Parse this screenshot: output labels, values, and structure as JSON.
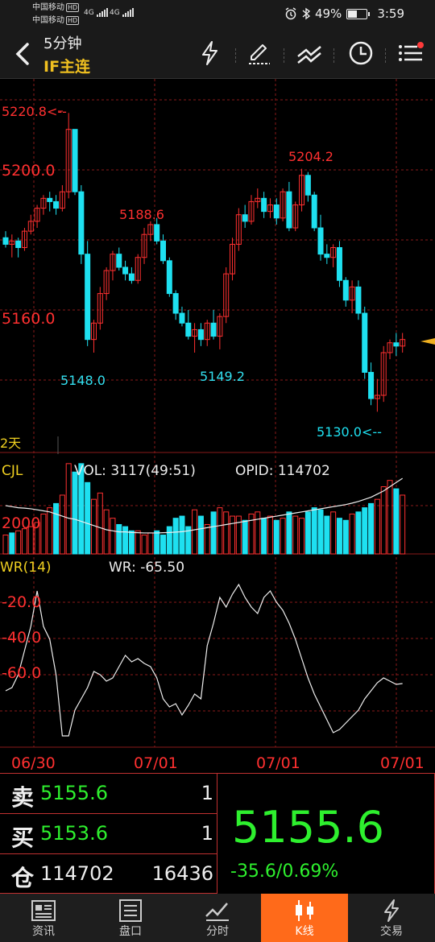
{
  "status_bar": {
    "carrier1": "中国移动",
    "carrier2": "中国移动",
    "hd": "HD",
    "net1": "4G",
    "net2": "4G",
    "battery": "49%",
    "time": "3:59"
  },
  "header": {
    "title": "5分钟",
    "contract": "IF主连"
  },
  "chart_data": {
    "type": "candlestick",
    "period": "5分钟",
    "price_panel": {
      "ylim": [
        5122,
        5225
      ],
      "y_labels": [
        "5200.0",
        "5160.0"
      ],
      "high_label": "5220.8<--",
      "low_label": "5130.0<--",
      "annotations": [
        {
          "text": "5188.6",
          "color": "#ff3030"
        },
        {
          "text": "5204.2",
          "color": "#ff3030"
        },
        {
          "text": "5148.0",
          "color": "#33e0f0"
        },
        {
          "text": "5149.2",
          "color": "#33e0f0"
        }
      ],
      "session_label": "2天",
      "candles": [
        [
          5183,
          5185,
          5180,
          5181
        ],
        [
          5181,
          5184,
          5177,
          5182
        ],
        [
          5182,
          5183,
          5177,
          5180
        ],
        [
          5180,
          5186,
          5179,
          5185
        ],
        [
          5185,
          5190,
          5184,
          5188
        ],
        [
          5188,
          5193,
          5186,
          5192
        ],
        [
          5192,
          5196,
          5190,
          5195
        ],
        [
          5195,
          5197,
          5191,
          5194
        ],
        [
          5194,
          5196,
          5190,
          5192
        ],
        [
          5192,
          5199,
          5191,
          5197
        ],
        [
          5197,
          5221,
          5195,
          5216
        ],
        [
          5216,
          5216,
          5196,
          5197
        ],
        [
          5197,
          5199,
          5175,
          5178
        ],
        [
          5178,
          5182,
          5150,
          5152
        ],
        [
          5152,
          5158,
          5148,
          5157
        ],
        [
          5157,
          5168,
          5155,
          5166
        ],
        [
          5166,
          5174,
          5164,
          5173
        ],
        [
          5173,
          5179,
          5170,
          5178
        ],
        [
          5178,
          5180,
          5173,
          5174
        ],
        [
          5174,
          5176,
          5170,
          5172
        ],
        [
          5172,
          5174,
          5169,
          5170
        ],
        [
          5170,
          5178,
          5169,
          5177
        ],
        [
          5177,
          5186,
          5175,
          5184
        ],
        [
          5184,
          5188,
          5182,
          5187
        ],
        [
          5187,
          5189,
          5181,
          5182
        ],
        [
          5182,
          5184,
          5175,
          5176
        ],
        [
          5176,
          5177,
          5165,
          5166
        ],
        [
          5166,
          5167,
          5158,
          5160
        ],
        [
          5160,
          5162,
          5156,
          5157
        ],
        [
          5157,
          5161,
          5152,
          5153
        ],
        [
          5153,
          5157,
          5148,
          5155
        ],
        [
          5155,
          5157,
          5150,
          5152
        ],
        [
          5152,
          5158,
          5150,
          5157
        ],
        [
          5157,
          5161,
          5152,
          5153
        ],
        [
          5153,
          5160,
          5149,
          5159
        ],
        [
          5159,
          5174,
          5157,
          5172
        ],
        [
          5172,
          5183,
          5170,
          5181
        ],
        [
          5181,
          5192,
          5179,
          5190
        ],
        [
          5190,
          5193,
          5186,
          5188
        ],
        [
          5188,
          5196,
          5187,
          5194
        ],
        [
          5194,
          5198,
          5192,
          5195
        ],
        [
          5195,
          5197,
          5189,
          5191
        ],
        [
          5191,
          5195,
          5189,
          5193
        ],
        [
          5193,
          5195,
          5187,
          5189
        ],
        [
          5189,
          5198,
          5188,
          5197
        ],
        [
          5197,
          5200,
          5185,
          5186
        ],
        [
          5186,
          5194,
          5185,
          5193
        ],
        [
          5193,
          5204,
          5191,
          5202
        ],
        [
          5202,
          5203,
          5194,
          5196
        ],
        [
          5196,
          5197,
          5185,
          5186
        ],
        [
          5186,
          5190,
          5176,
          5178
        ],
        [
          5178,
          5181,
          5175,
          5177
        ],
        [
          5177,
          5181,
          5174,
          5180
        ],
        [
          5180,
          5182,
          5168,
          5170
        ],
        [
          5170,
          5171,
          5162,
          5164
        ],
        [
          5164,
          5170,
          5160,
          5168
        ],
        [
          5168,
          5170,
          5158,
          5160
        ],
        [
          5160,
          5162,
          5140,
          5142
        ],
        [
          5142,
          5145,
          5132,
          5134
        ],
        [
          5134,
          5140,
          5130,
          5135
        ],
        [
          5135,
          5150,
          5133,
          5148
        ],
        [
          5148,
          5152,
          5146,
          5151
        ],
        [
          5151,
          5154,
          5147,
          5150
        ],
        [
          5150,
          5154,
          5148,
          5152
        ]
      ]
    },
    "volume_panel": {
      "label": "CJL",
      "vol_text": "VOL: 3117(49:51)",
      "opid_text": "OPID: 114702",
      "y_label": "2000",
      "ylim": [
        0,
        4600
      ],
      "values": [
        900,
        1000,
        1100,
        1200,
        1300,
        1500,
        1900,
        2200,
        2400,
        2800,
        4300,
        3900,
        4300,
        3400,
        2600,
        2900,
        2100,
        1700,
        1400,
        1300,
        1100,
        1100,
        900,
        1000,
        1100,
        900,
        1300,
        1700,
        1800,
        1300,
        2100,
        1800,
        1400,
        2000,
        2200,
        2000,
        1800,
        1800,
        1600,
        1900,
        2000,
        1700,
        1800,
        1600,
        1700,
        2000,
        1800,
        1700,
        2000,
        2200,
        2100,
        1800,
        2000,
        1700,
        1600,
        1900,
        2000,
        2200,
        2400,
        2600,
        3200,
        3500,
        3100,
        2800
      ],
      "up": [
        1,
        0,
        1,
        1,
        1,
        1,
        1,
        1,
        0,
        1,
        1,
        0,
        0,
        0,
        1,
        1,
        1,
        1,
        0,
        0,
        0,
        1,
        1,
        1,
        0,
        0,
        0,
        0,
        0,
        0,
        1,
        0,
        1,
        0,
        1,
        1,
        1,
        1,
        0,
        1,
        1,
        0,
        1,
        0,
        1,
        0,
        1,
        1,
        0,
        0,
        0,
        0,
        1,
        0,
        0,
        1,
        0,
        0,
        0,
        1,
        1,
        1,
        0,
        1
      ],
      "ma": [
        2300,
        2250,
        2200,
        2180,
        2150,
        2100,
        2050,
        2000,
        1900,
        1800,
        1700,
        1650,
        1550,
        1450,
        1350,
        1250,
        1150,
        1100,
        1050,
        1050,
        1020,
        1010,
        1000,
        1000,
        1000,
        1010,
        1020,
        1040,
        1060,
        1100,
        1150,
        1200,
        1250,
        1300,
        1350,
        1400,
        1450,
        1500,
        1550,
        1600,
        1650,
        1700,
        1750,
        1800,
        1850,
        1900,
        1950,
        2000,
        2050,
        2100,
        2150,
        2200,
        2250,
        2300,
        2350,
        2420,
        2500,
        2600,
        2700,
        2850,
        3000,
        3200,
        3400,
        3600
      ]
    },
    "wr_panel": {
      "label": "WR(14)",
      "wr_text": "WR: -65.50",
      "y_labels": [
        "-20.0",
        "-40.0",
        "-60.0"
      ],
      "ylim": [
        -105,
        5
      ],
      "values": [
        -70,
        -68,
        -60,
        -45,
        -30,
        -8,
        -30,
        -38,
        -60,
        -98,
        -98,
        -82,
        -75,
        -68,
        -58,
        -60,
        -64,
        -62,
        -55,
        -48,
        -52,
        -50,
        -53,
        -55,
        -62,
        -75,
        -80,
        -78,
        -85,
        -79,
        -72,
        -75,
        -42,
        -28,
        -12,
        -18,
        -10,
        -4,
        -12,
        -18,
        -22,
        -12,
        -8,
        -15,
        -20,
        -28,
        -38,
        -50,
        -62,
        -72,
        -80,
        -88,
        -96,
        -94,
        -90,
        -86,
        -82,
        -75,
        -70,
        -65,
        -62,
        -64,
        -66,
        -65.5
      ]
    },
    "x_labels": [
      "06/30",
      "07/01",
      "07/01",
      "07/01"
    ],
    "colors": {
      "up": "#ff3030",
      "down": "#1ee0f0",
      "grid": "#8a1a1a",
      "label": "#ff3030"
    }
  },
  "quote": {
    "sell_label": "卖",
    "sell_price": "5155.6",
    "sell_vol": "1",
    "buy_label": "买",
    "buy_price": "5153.6",
    "buy_vol": "1",
    "oi_label": "仓",
    "oi_value": "114702",
    "oi_change": "16436",
    "last_price": "5155.6",
    "change": "-35.6/0.69%"
  },
  "nav": {
    "items": [
      {
        "label": "资讯",
        "icon": "news-icon"
      },
      {
        "label": "盘口",
        "icon": "orderbook-icon"
      },
      {
        "label": "分时",
        "icon": "timeshare-icon"
      },
      {
        "label": "K线",
        "icon": "candlestick-icon"
      },
      {
        "label": "交易",
        "icon": "trade-icon"
      }
    ],
    "active": 3
  }
}
